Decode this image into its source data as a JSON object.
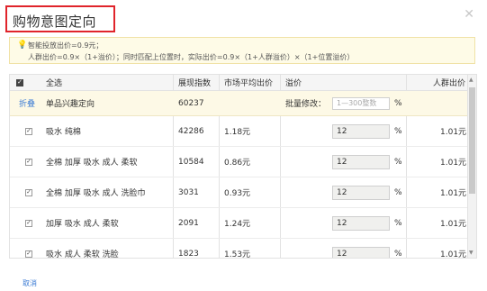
{
  "dialog": {
    "title": "购物意图定向",
    "close_icon": "close-icon"
  },
  "hint": {
    "icon": "lightbulb-icon",
    "line1": "智能投放出价=0.9元；",
    "line2": "人群出价=0.9×（1+溢价）；同时匹配上位置时，实际出价=0.9×（1+人群溢价）×（1+位置溢价）"
  },
  "table": {
    "headers": {
      "select_all": "全选",
      "impressions": "展现指数",
      "avg_bid": "市场平均出价",
      "premium": "溢价",
      "crowd_bid": "人群出价"
    },
    "bulk_row": {
      "collapse": "折叠",
      "name": "单品兴趣定向",
      "impressions": "60237",
      "bulk_label": "批量修改：",
      "placeholder": "1—300整数",
      "percent": "%"
    },
    "rows": [
      {
        "name": "吸水 纯棉",
        "impressions": "42286",
        "avg_bid": "1.18元",
        "premium": "12",
        "percent": "%",
        "crowd_bid": "1.01元"
      },
      {
        "name": "全棉 加厚 吸水 成人 柔软",
        "impressions": "10584",
        "avg_bid": "0.86元",
        "premium": "12",
        "percent": "%",
        "crowd_bid": "1.01元"
      },
      {
        "name": "全棉 加厚 吸水 成人 洗脸巾",
        "impressions": "3031",
        "avg_bid": "0.93元",
        "premium": "12",
        "percent": "%",
        "crowd_bid": "1.01元"
      },
      {
        "name": "加厚 吸水 成人 柔软",
        "impressions": "2091",
        "avg_bid": "1.24元",
        "premium": "12",
        "percent": "%",
        "crowd_bid": "1.01元"
      },
      {
        "name": "吸水 成人 柔软 洗脸",
        "impressions": "1823",
        "avg_bid": "1.53元",
        "premium": "12",
        "percent": "%",
        "crowd_bid": "1.01元"
      }
    ]
  },
  "footer": {
    "cancel": "取消"
  },
  "colors": {
    "title_highlight": "#e0242b",
    "link": "#3b7bd4",
    "hint_bg": "#fefbe7"
  }
}
